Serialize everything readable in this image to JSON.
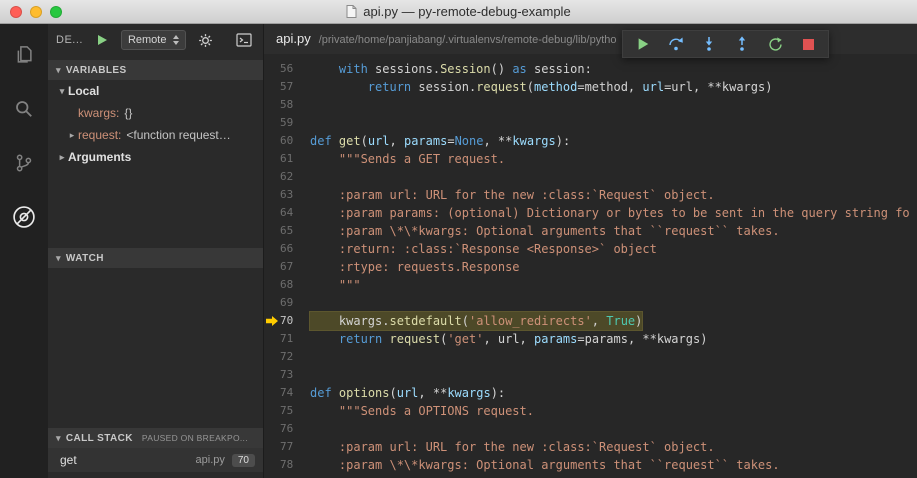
{
  "window": {
    "title": "api.py — py-remote-debug-example"
  },
  "activity_bar": {
    "items": [
      {
        "name": "explorer",
        "active": false
      },
      {
        "name": "search",
        "active": false
      },
      {
        "name": "source-control",
        "active": false
      },
      {
        "name": "debug",
        "active": true
      }
    ]
  },
  "sidebar": {
    "toolbar": {
      "title": "DE...",
      "config_name": "Remote"
    },
    "variables": {
      "header": "VARIABLES",
      "scopes": [
        {
          "label": "Local",
          "expanded": true,
          "items": [
            {
              "name": "kwargs:",
              "value": "{}"
            },
            {
              "name": "request:",
              "value": "<function request…"
            }
          ]
        },
        {
          "label": "Arguments",
          "expanded": false,
          "items": []
        }
      ]
    },
    "watch": {
      "header": "WATCH"
    },
    "call_stack": {
      "header": "CALL STACK",
      "status": "PAUSED ON BREAKPO...",
      "frames": [
        {
          "name": "get",
          "file": "api.py",
          "line": "70"
        }
      ]
    }
  },
  "editor": {
    "tab": {
      "filename": "api.py",
      "path": "/private/home/panjiabang/.virtualenvs/remote-debug/lib/pytho"
    },
    "debug_toolbar": {
      "buttons": [
        "continue",
        "step-over",
        "step-into",
        "step-out",
        "restart",
        "stop"
      ]
    },
    "code": {
      "lines": [
        {
          "n": 56,
          "tokens": [
            [
              "w",
              "    "
            ],
            [
              "k",
              "with"
            ],
            [
              "w",
              " sessions."
            ],
            [
              "f",
              "Session"
            ],
            [
              "w",
              "() "
            ],
            [
              "k",
              "as"
            ],
            [
              "w",
              " session:"
            ]
          ]
        },
        {
          "n": 57,
          "tokens": [
            [
              "w",
              "        "
            ],
            [
              "k",
              "return"
            ],
            [
              "w",
              " session."
            ],
            [
              "f",
              "request"
            ],
            [
              "w",
              "("
            ],
            [
              "p",
              "method"
            ],
            [
              "w",
              "=method, "
            ],
            [
              "p",
              "url"
            ],
            [
              "w",
              "=url, **kwargs)"
            ]
          ]
        },
        {
          "n": 58,
          "tokens": []
        },
        {
          "n": 59,
          "tokens": []
        },
        {
          "n": 60,
          "tokens": [
            [
              "k",
              "def"
            ],
            [
              "w",
              " "
            ],
            [
              "f",
              "get"
            ],
            [
              "w",
              "("
            ],
            [
              "p",
              "url"
            ],
            [
              "w",
              ", "
            ],
            [
              "p",
              "params"
            ],
            [
              "w",
              "="
            ],
            [
              "c",
              "None"
            ],
            [
              "w",
              ", **"
            ],
            [
              "p",
              "kwargs"
            ],
            [
              "w",
              "):"
            ]
          ]
        },
        {
          "n": 61,
          "tokens": [
            [
              "w",
              "    "
            ],
            [
              "s",
              "\"\"\"Sends a GET request."
            ]
          ]
        },
        {
          "n": 62,
          "tokens": []
        },
        {
          "n": 63,
          "tokens": [
            [
              "w",
              "    "
            ],
            [
              "s",
              ":param url: URL for the new :class:`Request` object."
            ]
          ]
        },
        {
          "n": 64,
          "tokens": [
            [
              "w",
              "    "
            ],
            [
              "s",
              ":param params: (optional) Dictionary or bytes to be sent in the query string fo"
            ]
          ]
        },
        {
          "n": 65,
          "tokens": [
            [
              "w",
              "    "
            ],
            [
              "s",
              ":param \\*\\*kwargs: Optional arguments that ``request`` takes."
            ]
          ]
        },
        {
          "n": 66,
          "tokens": [
            [
              "w",
              "    "
            ],
            [
              "s",
              ":return: :class:`Response <Response>` object"
            ]
          ]
        },
        {
          "n": 67,
          "tokens": [
            [
              "w",
              "    "
            ],
            [
              "s",
              ":rtype: requests.Response"
            ]
          ]
        },
        {
          "n": 68,
          "tokens": [
            [
              "w",
              "    "
            ],
            [
              "s",
              "\"\"\""
            ]
          ]
        },
        {
          "n": 69,
          "tokens": []
        },
        {
          "n": 70,
          "paused": true,
          "tokens": [
            [
              "w",
              "    kwargs."
            ],
            [
              "f",
              "setdefault"
            ],
            [
              "w",
              "("
            ],
            [
              "s",
              "'allow_redirects'"
            ],
            [
              "w",
              ", "
            ],
            [
              "t",
              "True"
            ],
            [
              "w",
              ")"
            ]
          ]
        },
        {
          "n": 71,
          "tokens": [
            [
              "w",
              "    "
            ],
            [
              "k",
              "return"
            ],
            [
              "w",
              " "
            ],
            [
              "f",
              "request"
            ],
            [
              "w",
              "("
            ],
            [
              "s",
              "'get'"
            ],
            [
              "w",
              ", url, "
            ],
            [
              "p",
              "params"
            ],
            [
              "w",
              "=params, **kwargs)"
            ]
          ]
        },
        {
          "n": 72,
          "tokens": []
        },
        {
          "n": 73,
          "tokens": []
        },
        {
          "n": 74,
          "tokens": [
            [
              "k",
              "def"
            ],
            [
              "w",
              " "
            ],
            [
              "f",
              "options"
            ],
            [
              "w",
              "("
            ],
            [
              "p",
              "url"
            ],
            [
              "w",
              ", **"
            ],
            [
              "p",
              "kwargs"
            ],
            [
              "w",
              "):"
            ]
          ]
        },
        {
          "n": 75,
          "tokens": [
            [
              "w",
              "    "
            ],
            [
              "s",
              "\"\"\"Sends a OPTIONS request."
            ]
          ]
        },
        {
          "n": 76,
          "tokens": []
        },
        {
          "n": 77,
          "tokens": [
            [
              "w",
              "    "
            ],
            [
              "s",
              ":param url: URL for the new :class:`Request` object."
            ]
          ]
        },
        {
          "n": 78,
          "tokens": [
            [
              "w",
              "    "
            ],
            [
              "s",
              ":param \\*\\*kwargs: Optional arguments that ``request`` takes."
            ]
          ]
        }
      ]
    }
  },
  "colors": {
    "paused_line": "#4d4928",
    "breakpoint_arrow": "#ffcc00",
    "continue_green": "#89d185",
    "step_blue": "#75beff",
    "stop_red": "#e05252"
  }
}
